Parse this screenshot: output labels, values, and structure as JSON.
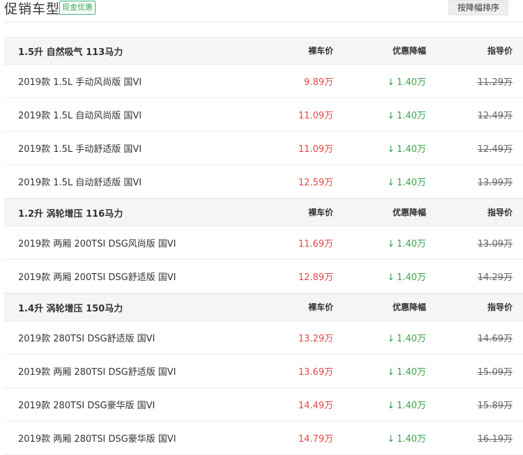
{
  "header": {
    "title": "促销车型",
    "badge": "现金优惠",
    "sort_label": "按降幅排序"
  },
  "columns": {
    "price": "裸车价",
    "discount": "优惠降幅",
    "msrp": "指导价"
  },
  "groups": [
    {
      "title": "1.5升 自然吸气 113马力",
      "rows": [
        {
          "model": "2019款 1.5L 手动风尚版 国VI",
          "price": "9.89万",
          "discount": "1.40万",
          "msrp": "11.29万"
        },
        {
          "model": "2019款 1.5L 自动风尚版 国VI",
          "price": "11.09万",
          "discount": "1.40万",
          "msrp": "12.49万"
        },
        {
          "model": "2019款 1.5L 手动舒适版 国VI",
          "price": "11.09万",
          "discount": "1.40万",
          "msrp": "12.49万"
        },
        {
          "model": "2019款 1.5L 自动舒适版 国VI",
          "price": "12.59万",
          "discount": "1.40万",
          "msrp": "13.99万"
        }
      ]
    },
    {
      "title": "1.2升 涡轮增压 116马力",
      "rows": [
        {
          "model": "2019款 两厢 200TSI DSG风尚版 国VI",
          "price": "11.69万",
          "discount": "1.40万",
          "msrp": "13.09万"
        },
        {
          "model": "2019款 两厢 200TSI DSG舒适版 国VI",
          "price": "12.89万",
          "discount": "1.40万",
          "msrp": "14.29万"
        }
      ]
    },
    {
      "title": "1.4升 涡轮增压 150马力",
      "rows": [
        {
          "model": "2019款 280TSI DSG舒适版 国VI",
          "price": "13.29万",
          "discount": "1.40万",
          "msrp": "14.69万"
        },
        {
          "model": "2019款 两厢 280TSI DSG舒适版 国VI",
          "price": "13.69万",
          "discount": "1.40万",
          "msrp": "15.09万"
        },
        {
          "model": "2019款 280TSI DSG豪华版 国VI",
          "price": "14.49万",
          "discount": "1.40万",
          "msrp": "15.89万"
        },
        {
          "model": "2019款 两厢 280TSI DSG豪华版 国VI",
          "price": "14.79万",
          "discount": "1.40万",
          "msrp": "16.19万"
        }
      ]
    }
  ]
}
